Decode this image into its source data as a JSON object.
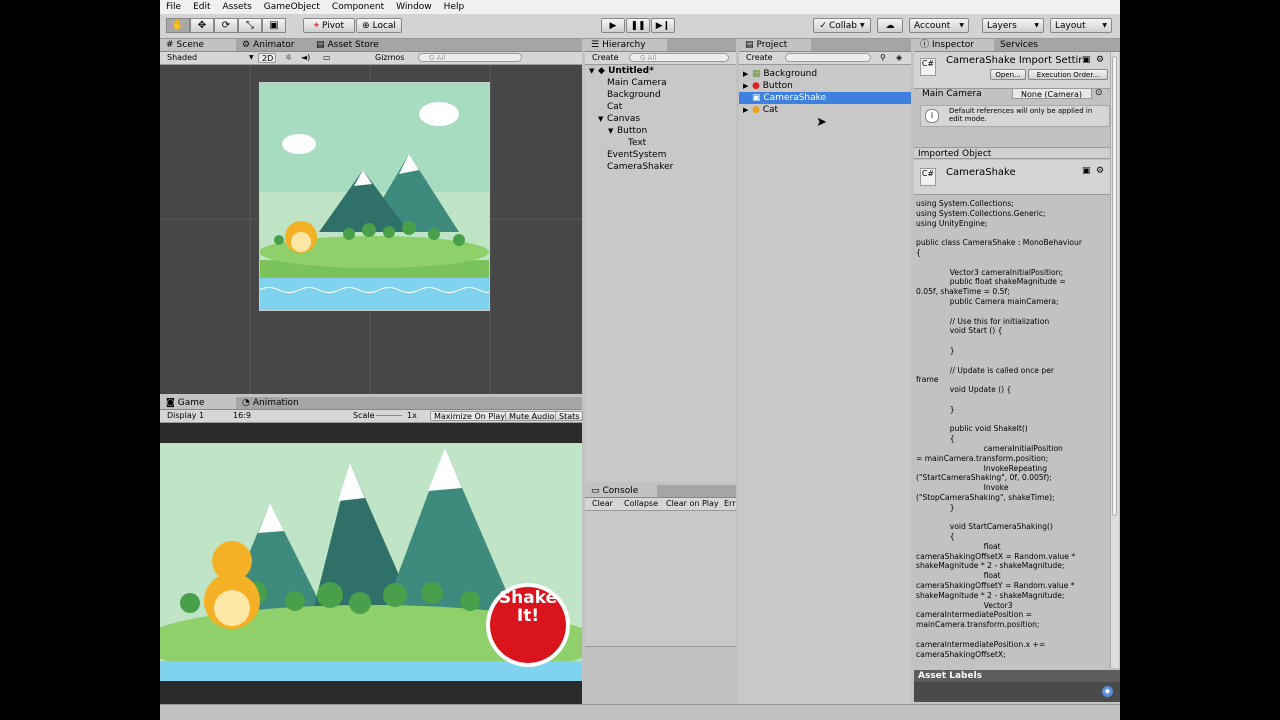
{
  "menu": [
    "File",
    "Edit",
    "Assets",
    "GameObject",
    "Component",
    "Window",
    "Help"
  ],
  "toolbar": {
    "tools": [
      "hand-icon",
      "move-icon",
      "rotate-icon",
      "scale-icon",
      "rect-icon"
    ],
    "pivot": "Pivot",
    "local": "Local",
    "collab": "Collab",
    "account": "Account",
    "layers": "Layers",
    "layout": "Layout"
  },
  "scene": {
    "tabs": [
      "Scene",
      "Animator",
      "Asset Store"
    ],
    "shading": "Shaded",
    "mode2d": "2D",
    "gizmos": "Gizmos",
    "search_placeholder": "G All"
  },
  "game": {
    "tabs": [
      "Game",
      "Animation"
    ],
    "display": "Display 1",
    "aspect": "16:9",
    "scale_label": "Scale",
    "scale_value": "1x",
    "maximize": "Maximize On Play",
    "mute": "Mute Audio",
    "stats": "Stats",
    "button_line1": "Shake",
    "button_line2": "It!"
  },
  "hierarchy": {
    "tab": "Hierarchy",
    "create": "Create",
    "search_placeholder": "G All",
    "scene_name": "Untitled*",
    "items": [
      "Main Camera",
      "Background",
      "Cat",
      "Canvas",
      "Button",
      "Text",
      "EventSystem",
      "CameraShaker"
    ]
  },
  "console": {
    "tab": "Console",
    "clear": "Clear",
    "collapse": "Collapse",
    "clear_on_play": "Clear on Play",
    "err": "Err"
  },
  "project": {
    "tab": "Project",
    "create": "Create",
    "items": [
      "Background",
      "Button",
      "CameraShake",
      "Cat"
    ],
    "selected": "CameraShake"
  },
  "inspector": {
    "tabs": [
      "Inspector",
      "Services"
    ],
    "title": "CameraShake Import Settir",
    "open": "Open...",
    "execution_order": "Execution Order...",
    "main_camera_label": "Main Camera",
    "main_camera_value": "None (Camera)",
    "info": "Default references will only be applied in edit mode.",
    "imported_object": "Imported Object",
    "asset_name": "CameraShake",
    "asset_labels": "Asset Labels",
    "code": "using System.Collections;\nusing System.Collections.Generic;\nusing UnityEngine;\n\npublic class CameraShake : MonoBehaviour\n{\n\n              Vector3 cameraInitialPosition;\n              public float shakeMagnitude =\n0.05f, shakeTime = 0.5f;\n              public Camera mainCamera;\n\n              // Use this for initialization\n              void Start () {\n\n              }\n\n              // Update is called once per\nframe\n              void Update () {\n\n              }\n\n              public void ShakeIt()\n              {\n                            cameraInitialPosition\n= mainCamera.transform.position;\n                            InvokeRepeating\n(\"StartCameraShaking\", 0f, 0.005f);\n                            Invoke\n(\"StopCameraShaking\", shakeTime);\n              }\n\n              void StartCameraShaking()\n              {\n                            float\ncameraShakingOffsetX = Random.value *\nshakeMagnitude * 2 - shakeMagnitude;\n                            float\ncameraShakingOffsetY = Random.value *\nshakeMagnitude * 2 - shakeMagnitude;\n                            Vector3\ncameraIntermediatePosition =\nmainCamera.transform.position;\n\ncameraIntermediatePosition.x +=\ncameraShakingOffsetX;"
  }
}
